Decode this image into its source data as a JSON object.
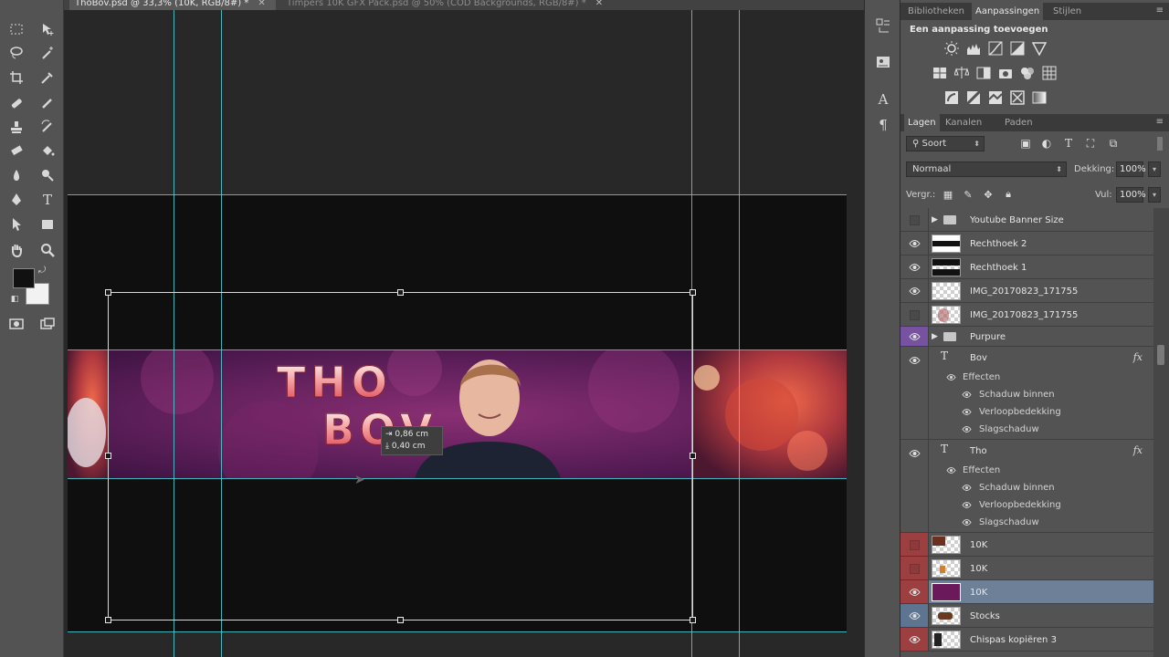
{
  "doc_tabs": [
    {
      "title": "ThoBov.psd @ 33,3% (10K, RGB/8#) *",
      "active": true
    },
    {
      "title": "Timpers 10K GFX Pack.psd @ 50% (COD Backgrounds, RGB/8#) *",
      "active": false
    }
  ],
  "canvas": {
    "banner_text_line1": "THO",
    "banner_text_line2": "BOV",
    "measure_dx": "0,86 cm",
    "measure_dy": "0,40 cm"
  },
  "top_panel": {
    "tabs": [
      "Bibliotheken",
      "Aanpassingen",
      "Stijlen"
    ],
    "active_tab": "Aanpassingen",
    "title": "Een aanpassing toevoegen",
    "icons_row1": [
      "brightness-icon",
      "levels-icon",
      "curves-icon",
      "exposure-icon",
      "vibrance-icon"
    ],
    "icons_row2": [
      "hue-saturation-icon",
      "color-balance-icon",
      "black-white-icon",
      "photo-filter-icon",
      "channel-mixer-icon",
      "color-lookup-icon"
    ],
    "icons_row3": [
      "invert-icon",
      "posterize-icon",
      "threshold-icon",
      "selective-color-icon",
      "gradient-map-icon"
    ]
  },
  "layers_panel": {
    "tabs": [
      "Lagen",
      "Kanalen",
      "Paden"
    ],
    "active_tab": "Lagen",
    "filter_label": "Soort",
    "blend_mode": "Normaal",
    "opacity_label": "Dekking:",
    "opacity_value": "100%",
    "lock_label": "Vergr.:",
    "fill_label": "Vul:",
    "fill_value": "100%",
    "effects_label": "Effecten",
    "effects": [
      "Schaduw binnen",
      "Verloopbedekking",
      "Slagschaduw"
    ],
    "fx_label": "fx",
    "layers": [
      {
        "name": "Youtube Banner Size",
        "type": "group",
        "visible": false
      },
      {
        "name": "Rechthoek 2",
        "type": "shape",
        "visible": true
      },
      {
        "name": "Rechthoek 1",
        "type": "shape",
        "visible": true
      },
      {
        "name": "IMG_20170823_171755",
        "type": "image",
        "visible": true
      },
      {
        "name": "IMG_20170823_171755",
        "type": "image",
        "visible": false
      },
      {
        "name": "Purpure",
        "type": "group",
        "visible": true,
        "color": "#7752a0"
      },
      {
        "name": "Bov",
        "type": "text",
        "visible": true
      },
      {
        "name": "Tho",
        "type": "text",
        "visible": true
      },
      {
        "name": "10K",
        "type": "image",
        "visible": false,
        "color": "#9c3f40"
      },
      {
        "name": "10K",
        "type": "image",
        "visible": false,
        "color": "#9c3f40"
      },
      {
        "name": "10K",
        "type": "image",
        "visible": true,
        "color": "#9c3f40",
        "selected": true
      },
      {
        "name": "Stocks",
        "type": "image",
        "visible": true,
        "color": "#5d7591"
      },
      {
        "name": "Chispas kopiëren 3",
        "type": "image",
        "visible": true,
        "color": "#9c3f40"
      }
    ]
  },
  "colors": {
    "guide": "#4fd0d6",
    "selected_layer": "#6e7f98",
    "foreground": "#111111",
    "background": "#f2f2f2"
  }
}
